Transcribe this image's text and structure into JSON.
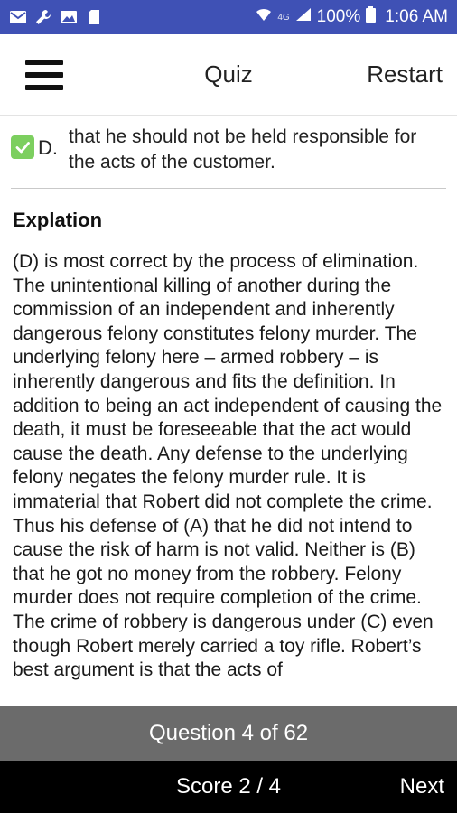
{
  "status_bar": {
    "battery": "100%",
    "time": "1:06 AM",
    "network": "4G",
    "icons": [
      "mail-icon",
      "wrench-icon",
      "image-icon",
      "sd-card-icon",
      "wifi-icon",
      "signal-icon",
      "battery-icon"
    ]
  },
  "app_bar": {
    "title": "Quiz",
    "restart_label": "Restart"
  },
  "answer": {
    "letter": "D.",
    "text": "that he should not be held responsible for the acts of the customer."
  },
  "explanation": {
    "title": "Explation",
    "body": "(D) is most correct by the process of elimination. The unintentional killing of another during the commission of an independent and inherently dangerous felony constitutes felony murder. The underlying felony here – armed robbery – is inherently dangerous and fits the definition. In addition to being an act independent of causing the death, it must be foreseeable that the act would cause the death. Any defense to the underlying felony negates the felony murder rule. It is immaterial that Robert did not complete the crime. Thus his defense of (A) that he did not intend to cause the risk of harm is not valid. Neither is (B) that he got no money from the robbery. Felony murder does not require completion of the crime. The crime of robbery is dangerous under (C) even though Robert merely carried a toy rifle. Robert’s best argument is that the acts of"
  },
  "question_bar": {
    "label": "Question 4 of 62"
  },
  "bottom_bar": {
    "score_label": "Score 2 / 4",
    "next_label": "Next"
  },
  "colors": {
    "status_bar": "#3f51b5",
    "check_green": "#7ccf5f",
    "question_bar": "#6b6b6b",
    "bottom_bar": "#000000"
  }
}
